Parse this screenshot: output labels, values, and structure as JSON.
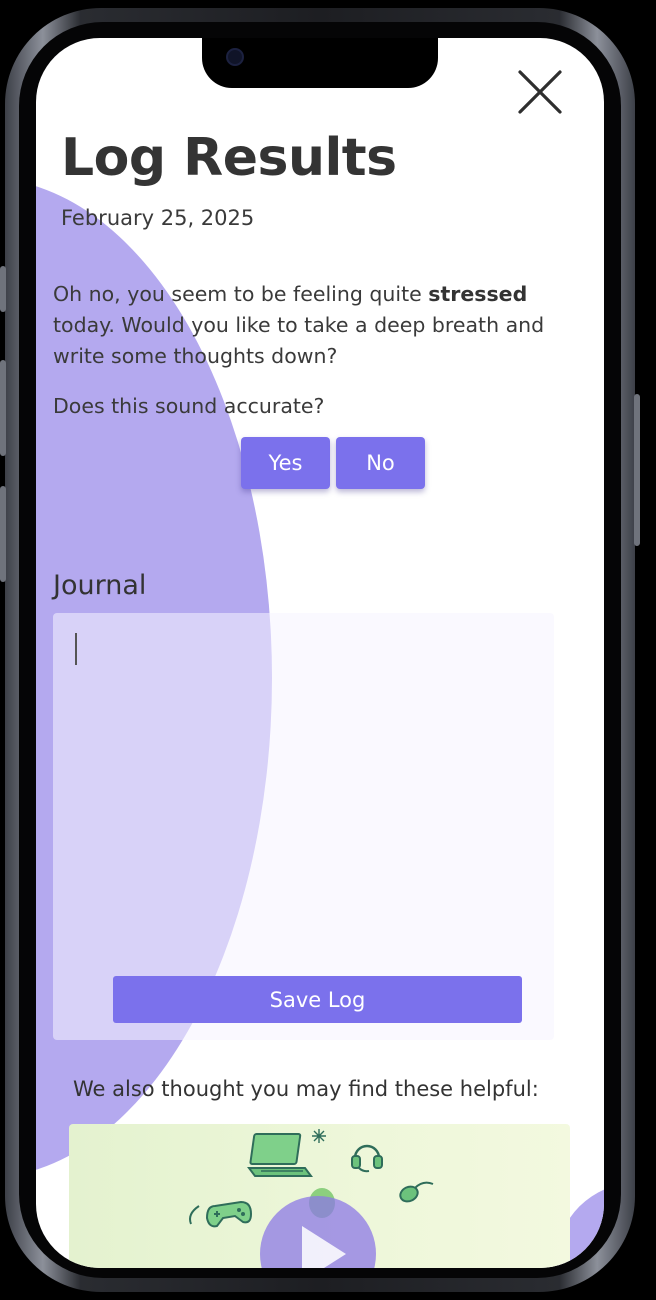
{
  "header": {
    "title": "Log Results",
    "date": "February 25, 2025",
    "close_icon": "close-icon"
  },
  "assessment": {
    "message_before": "Oh no, you seem to be feeling quite ",
    "mood": "stressed",
    "message_after": " today. Would you like to take a deep breath and write some thoughts down?",
    "question": "Does this sound accurate?",
    "yes_label": "Yes",
    "no_label": "No"
  },
  "journal": {
    "label": "Journal",
    "value": "",
    "save_label": "Save Log"
  },
  "resources": {
    "intro": "We also thought you may find these helpful:",
    "items": [
      {
        "icons": [
          "laptop-icon",
          "headset-icon",
          "game-controller-icon",
          "mouse-icon",
          "sparkle-icon"
        ],
        "media_icon": "play-icon"
      }
    ]
  },
  "colors": {
    "accent": "#7b71ec",
    "blob": "#b4a9ef",
    "text": "#333333",
    "card_bg": "#e8f4d4"
  }
}
